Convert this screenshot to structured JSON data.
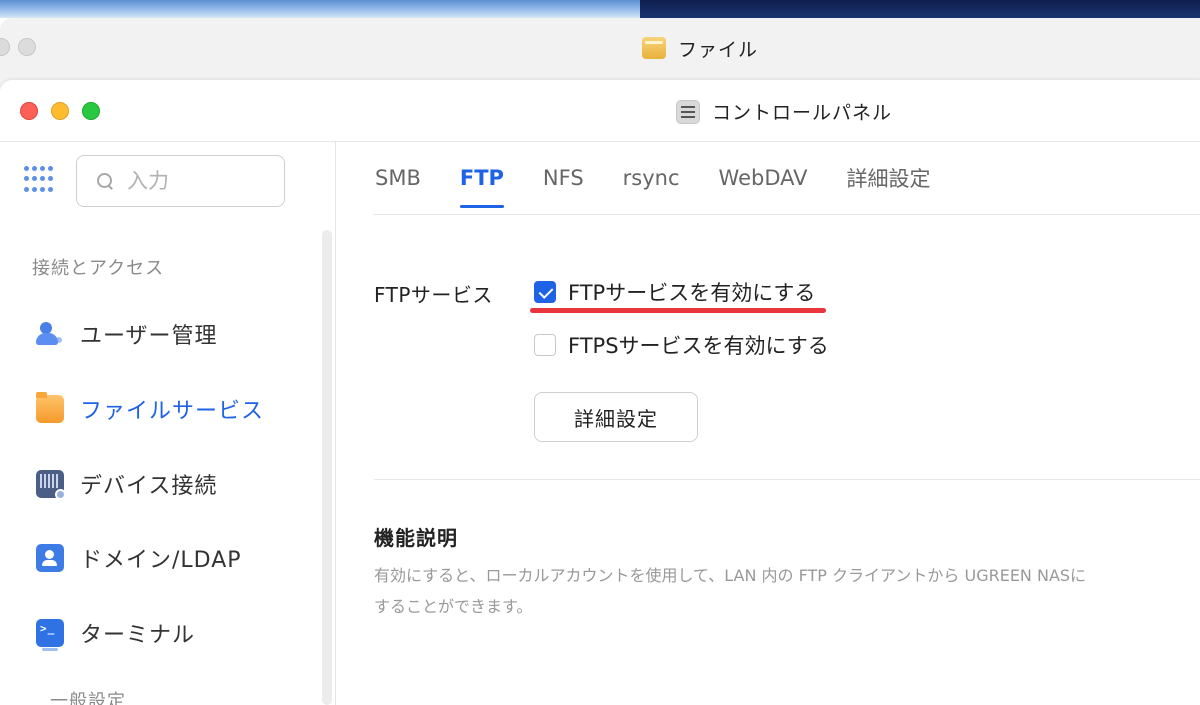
{
  "back_window": {
    "title": "ファイル"
  },
  "window": {
    "title": "コントロールパネル"
  },
  "sidebar": {
    "search": {
      "placeholder": "入力",
      "value": ""
    },
    "section_title": "接続とアクセス",
    "items": [
      {
        "label": "ユーザー管理",
        "icon": "user-management-icon",
        "active": false
      },
      {
        "label": "ファイルサービス",
        "icon": "folder-icon",
        "active": true
      },
      {
        "label": "デバイス接続",
        "icon": "device-icon",
        "active": false
      },
      {
        "label": "ドメイン/LDAP",
        "icon": "domain-icon",
        "active": false
      },
      {
        "label": "ターミナル",
        "icon": "terminal-icon",
        "active": false
      }
    ],
    "next_section_partial": "一般設定"
  },
  "tabs": [
    {
      "label": "SMB",
      "active": false
    },
    {
      "label": "FTP",
      "active": true
    },
    {
      "label": "NFS",
      "active": false
    },
    {
      "label": "rsync",
      "active": false
    },
    {
      "label": "WebDAV",
      "active": false
    },
    {
      "label": "詳細設定",
      "active": false
    }
  ],
  "ftp": {
    "service_label": "FTPサービス",
    "enable_ftp": {
      "label": "FTPサービスを有効にする",
      "checked": true
    },
    "enable_ftps": {
      "label": "FTPSサービスを有効にする",
      "checked": false
    },
    "advanced_button": "詳細設定"
  },
  "description": {
    "title": "機能説明",
    "text": "有効にすると、ローカルアカウントを使用して、LAN 内の FTP クライアントから UGREEN NASに\nすることができます。"
  },
  "colors": {
    "accent": "#1e62e6",
    "highlight_underline": "#e8343b"
  }
}
